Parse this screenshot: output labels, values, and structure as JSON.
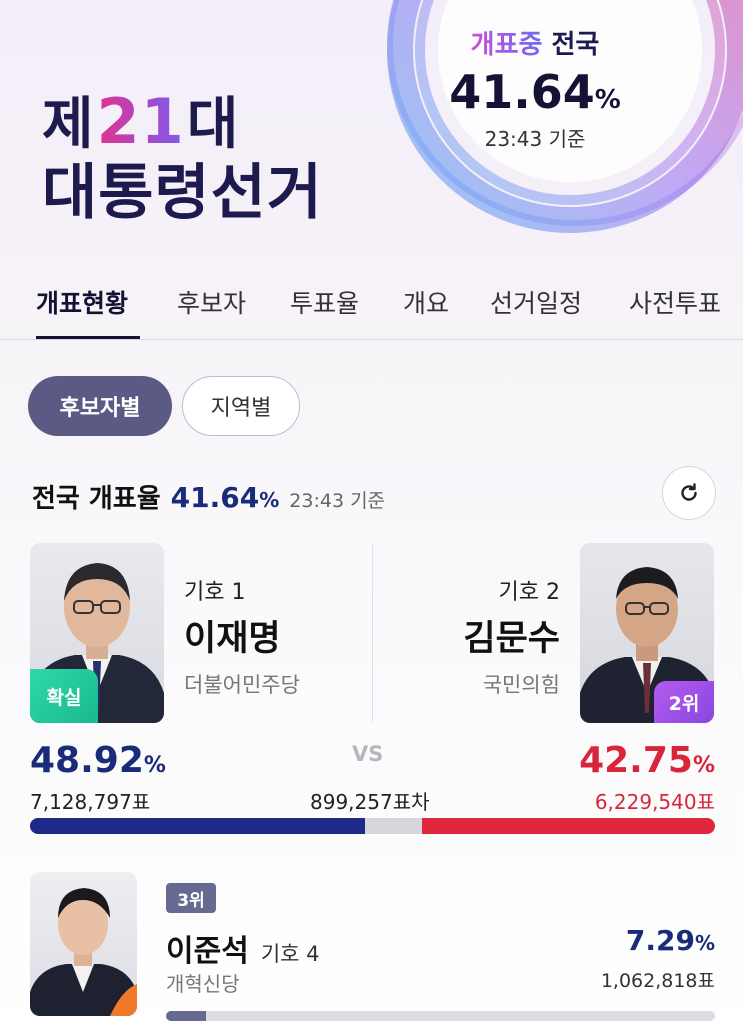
{
  "header": {
    "title_prefix": "제",
    "title_number": "21",
    "title_suffix": "대",
    "title_line2": "대통령선거",
    "status_label_1": "개표중",
    "status_label_2": "전국",
    "count_rate": "41.64",
    "pct_sign": "%",
    "time": "23:43 기준"
  },
  "tabs": [
    "개표현황",
    "후보자",
    "투표율",
    "개요",
    "선거일정",
    "사전투표"
  ],
  "filters": [
    "후보자별",
    "지역별"
  ],
  "national": {
    "label": "전국 개표율",
    "rate": "41.64",
    "pct_sign": "%",
    "time": "23:43 기준"
  },
  "candidates": {
    "c1": {
      "number": "기호 1",
      "name": "이재명",
      "party": "더불어민주당",
      "badge": "확실",
      "percent": "48.92",
      "votes": "7,128,797표",
      "color": "#1e2a8a"
    },
    "c2": {
      "number": "기호 2",
      "name": "김문수",
      "party": "국민의힘",
      "badge": "2위",
      "percent": "42.75",
      "votes": "6,229,540표",
      "color": "#e0273d"
    },
    "vs": "VS",
    "difference": "899,257표차",
    "c3": {
      "rank": "3위",
      "name": "이준석",
      "number": "기호 4",
      "party": "개혁신당",
      "percent": "7.29",
      "votes": "1,062,818표",
      "share": 0.0729
    }
  },
  "bar_shares": {
    "c1": 0.4892,
    "c2": 0.4275
  }
}
